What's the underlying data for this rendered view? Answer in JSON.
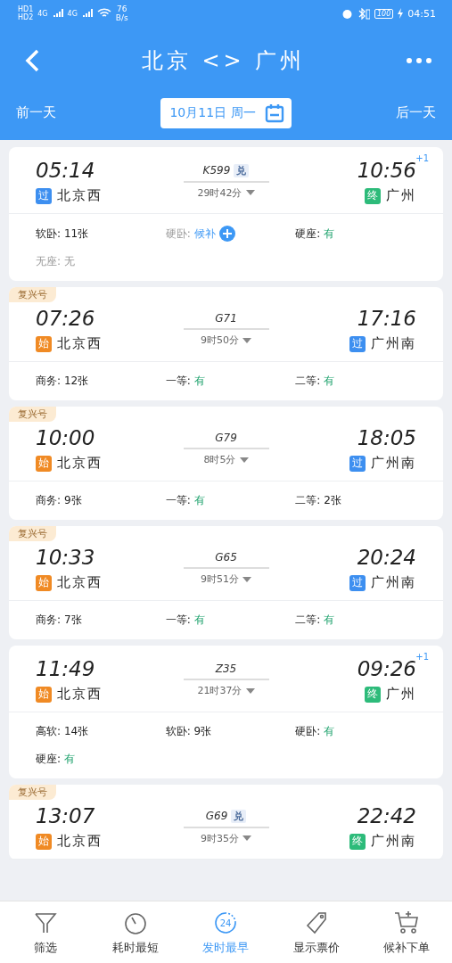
{
  "status_bar": {
    "sims": [
      "HD1",
      "HD2"
    ],
    "networks": [
      "4G",
      "4G"
    ],
    "speed": "76\nB/s",
    "battery": "100",
    "time": "04:51"
  },
  "title_bar": {
    "title": "北京 <> 广州"
  },
  "date_bar": {
    "prev": "前一天",
    "date": "10月11日 周一",
    "next": "后一天"
  },
  "trains": [
    {
      "depart": "05:14",
      "depart_tag": {
        "text": "过",
        "kind": "pass"
      },
      "from": "北京西",
      "number": "K599",
      "exchange": "兑",
      "duration": "29时42分",
      "arrive": "10:56",
      "plus_day": "+1",
      "arrive_tag": {
        "text": "终",
        "kind": "end"
      },
      "to": "广州",
      "seats": [
        {
          "label": "软卧:",
          "value": "11张",
          "kind": "count"
        },
        {
          "label": "硬卧:",
          "value": "候补",
          "kind": "waitlist"
        },
        {
          "label": "硬座:",
          "value": "有",
          "kind": "yes"
        },
        {
          "label": "无座:",
          "value": "无",
          "kind": "none"
        }
      ]
    },
    {
      "badge": "复兴号",
      "depart": "07:26",
      "depart_tag": {
        "text": "始",
        "kind": "start"
      },
      "from": "北京西",
      "number": "G71",
      "duration": "9时50分",
      "arrive": "17:16",
      "arrive_tag": {
        "text": "过",
        "kind": "pass"
      },
      "to": "广州南",
      "seats": [
        {
          "label": "商务:",
          "value": "12张",
          "kind": "count"
        },
        {
          "label": "一等:",
          "value": "有",
          "kind": "yes"
        },
        {
          "label": "二等:",
          "value": "有",
          "kind": "yes"
        }
      ]
    },
    {
      "badge": "复兴号",
      "depart": "10:00",
      "depart_tag": {
        "text": "始",
        "kind": "start"
      },
      "from": "北京西",
      "number": "G79",
      "duration": "8时5分",
      "arrive": "18:05",
      "arrive_tag": {
        "text": "过",
        "kind": "pass"
      },
      "to": "广州南",
      "seats": [
        {
          "label": "商务:",
          "value": "9张",
          "kind": "count"
        },
        {
          "label": "一等:",
          "value": "有",
          "kind": "yes"
        },
        {
          "label": "二等:",
          "value": "2张",
          "kind": "count"
        }
      ]
    },
    {
      "badge": "复兴号",
      "depart": "10:33",
      "depart_tag": {
        "text": "始",
        "kind": "start"
      },
      "from": "北京西",
      "number": "G65",
      "duration": "9时51分",
      "arrive": "20:24",
      "arrive_tag": {
        "text": "过",
        "kind": "pass"
      },
      "to": "广州南",
      "seats": [
        {
          "label": "商务:",
          "value": "7张",
          "kind": "count"
        },
        {
          "label": "一等:",
          "value": "有",
          "kind": "yes"
        },
        {
          "label": "二等:",
          "value": "有",
          "kind": "yes"
        }
      ]
    },
    {
      "depart": "11:49",
      "depart_tag": {
        "text": "始",
        "kind": "start"
      },
      "from": "北京西",
      "number": "Z35",
      "duration": "21时37分",
      "arrive": "09:26",
      "plus_day": "+1",
      "arrive_tag": {
        "text": "终",
        "kind": "end"
      },
      "to": "广州",
      "seats": [
        {
          "label": "高软:",
          "value": "14张",
          "kind": "count"
        },
        {
          "label": "软卧:",
          "value": "9张",
          "kind": "count"
        },
        {
          "label": "硬卧:",
          "value": "有",
          "kind": "yes"
        },
        {
          "label": "硬座:",
          "value": "有",
          "kind": "yes"
        }
      ]
    },
    {
      "badge": "复兴号",
      "depart": "13:07",
      "depart_tag": {
        "text": "始",
        "kind": "start"
      },
      "from": "北京西",
      "number": "G69",
      "exchange": "兑",
      "duration": "9时35分",
      "arrive": "22:42",
      "arrive_tag": {
        "text": "终",
        "kind": "end"
      },
      "to": "广州南"
    }
  ],
  "bottom_nav": [
    {
      "label": "筛选",
      "kind": "filter",
      "selected": false
    },
    {
      "label": "耗时最短",
      "kind": "timer",
      "selected": false
    },
    {
      "label": "发时最早",
      "kind": "clock24",
      "icon_text": "24",
      "selected": true
    },
    {
      "label": "显示票价",
      "kind": "tag",
      "selected": false
    },
    {
      "label": "候补下单",
      "kind": "cart",
      "selected": false
    }
  ]
}
